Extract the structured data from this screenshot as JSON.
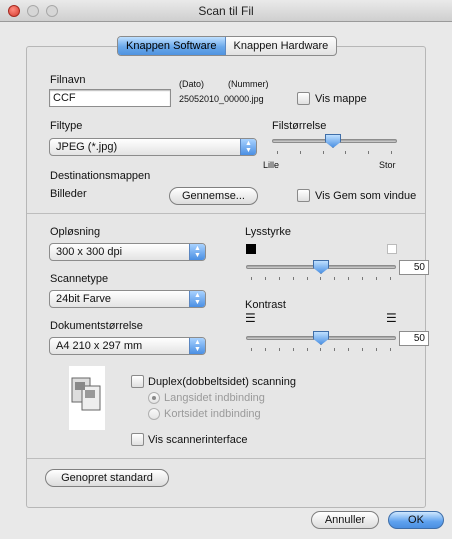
{
  "window": {
    "title": "Scan til Fil"
  },
  "tabs": [
    {
      "label": "Knappen Software",
      "active": true
    },
    {
      "label": "Knappen Hardware",
      "active": false
    }
  ],
  "file": {
    "filename_label": "Filnavn",
    "filename_value": "CCF",
    "date_label": "(Dato)",
    "number_label": "(Nummer)",
    "example_name": "25052010_00000.jpg",
    "show_folder_label": "Vis mappe",
    "filetype_label": "Filtype",
    "filetype_value": "JPEG (*.jpg)",
    "filesize_label": "Filstørrelse",
    "filesize_min_label": "Lille",
    "filesize_max_label": "Stor",
    "filesize_level": 0.5,
    "destination_label": "Destinationsmappen",
    "destination_value": "Billeder",
    "browse_label": "Gennemse...",
    "show_save_label": "Vis Gem som vindue"
  },
  "scan": {
    "resolution_label": "Opløsning",
    "resolution_value": "300 x 300 dpi",
    "scantype_label": "Scannetype",
    "scantype_value": "24bit Farve",
    "docsize_label": "Dokumentstørrelse",
    "docsize_value": "A4  210 x 297 mm",
    "brightness_label": "Lysstyrke",
    "brightness_value": "50",
    "contrast_label": "Kontrast",
    "contrast_value": "50",
    "duplex_label": "Duplex(dobbeltsidet) scanning",
    "long_edge_label": "Langsidet indbinding",
    "short_edge_label": "Kortsidet indbinding",
    "show_scanner_label": "Vis scannerinterface"
  },
  "buttons": {
    "restore_label": "Genopret standard",
    "cancel_label": "Annuller",
    "ok_label": "OK"
  },
  "colors": {
    "accent": "#4f93e0",
    "window_bg": "#e9e9e9"
  }
}
